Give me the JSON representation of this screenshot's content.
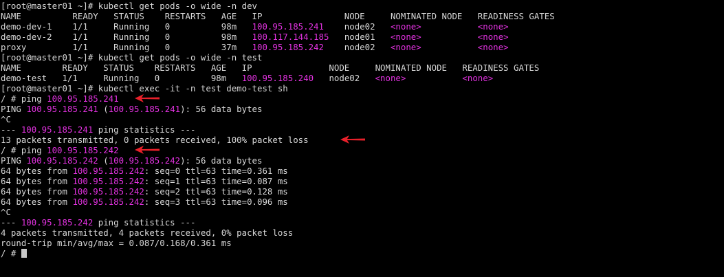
{
  "terminal": {
    "lines": [
      [
        {
          "t": "[root@master01 ~]# kubectl get pods -o wide -n dev"
        }
      ],
      [
        {
          "t": "NAME          READY   STATUS    RESTARTS   AGE   IP                NODE     NOMINATED NODE   READINESS GATES"
        }
      ],
      [
        {
          "t": "demo-dev-1    1/1     Running   0          98m   "
        },
        {
          "t": "100.95.185.241",
          "c": "m"
        },
        {
          "t": "    node02   "
        },
        {
          "t": "<none>",
          "c": "m"
        },
        {
          "t": "           "
        },
        {
          "t": "<none>",
          "c": "m"
        }
      ],
      [
        {
          "t": "demo-dev-2    1/1     Running   0          98m   "
        },
        {
          "t": "100.117.144.185",
          "c": "m"
        },
        {
          "t": "   node01   "
        },
        {
          "t": "<none>",
          "c": "m"
        },
        {
          "t": "           "
        },
        {
          "t": "<none>",
          "c": "m"
        }
      ],
      [
        {
          "t": "proxy         1/1     Running   0          37m   "
        },
        {
          "t": "100.95.185.242",
          "c": "m"
        },
        {
          "t": "    node02   "
        },
        {
          "t": "<none>",
          "c": "m"
        },
        {
          "t": "           "
        },
        {
          "t": "<none>",
          "c": "m"
        }
      ],
      [
        {
          "t": "[root@master01 ~]# kubectl get pods -o wide -n test"
        }
      ],
      [
        {
          "t": "NAME        READY   STATUS    RESTARTS   AGE   IP               NODE     NOMINATED NODE   READINESS GATES"
        }
      ],
      [
        {
          "t": "demo-test   1/1     Running   0          98m   "
        },
        {
          "t": "100.95.185.240",
          "c": "m"
        },
        {
          "t": "   node02   "
        },
        {
          "t": "<none>",
          "c": "m"
        },
        {
          "t": "           "
        },
        {
          "t": "<none>",
          "c": "m"
        }
      ],
      [
        {
          "t": "[root@master01 ~]# kubectl exec -it -n test demo-test sh"
        }
      ],
      [
        {
          "t": "/ # ping "
        },
        {
          "t": "100.95.185.241",
          "c": "m"
        }
      ],
      [
        {
          "t": "PING "
        },
        {
          "t": "100.95.185.241",
          "c": "m"
        },
        {
          "t": " ("
        },
        {
          "t": "100.95.185.241",
          "c": "m"
        },
        {
          "t": "): 56 data bytes"
        }
      ],
      [
        {
          "t": "^C"
        }
      ],
      [
        {
          "t": "--- "
        },
        {
          "t": "100.95.185.241",
          "c": "m"
        },
        {
          "t": " ping statistics ---"
        }
      ],
      [
        {
          "t": "13 packets transmitted, 0 packets received, 100% packet loss"
        }
      ],
      [
        {
          "t": "/ # ping "
        },
        {
          "t": "100.95.185.242",
          "c": "m"
        }
      ],
      [
        {
          "t": "PING "
        },
        {
          "t": "100.95.185.242",
          "c": "m"
        },
        {
          "t": " ("
        },
        {
          "t": "100.95.185.242",
          "c": "m"
        },
        {
          "t": "): 56 data bytes"
        }
      ],
      [
        {
          "t": "64 bytes from "
        },
        {
          "t": "100.95.185.242",
          "c": "m"
        },
        {
          "t": ": seq=0 ttl=63 time=0.361 ms"
        }
      ],
      [
        {
          "t": "64 bytes from "
        },
        {
          "t": "100.95.185.242",
          "c": "m"
        },
        {
          "t": ": seq=1 ttl=63 time=0.087 ms"
        }
      ],
      [
        {
          "t": "64 bytes from "
        },
        {
          "t": "100.95.185.242",
          "c": "m"
        },
        {
          "t": ": seq=2 ttl=63 time=0.128 ms"
        }
      ],
      [
        {
          "t": "64 bytes from "
        },
        {
          "t": "100.95.185.242",
          "c": "m"
        },
        {
          "t": ": seq=3 ttl=63 time=0.096 ms"
        }
      ],
      [
        {
          "t": "^C"
        }
      ],
      [
        {
          "t": "--- "
        },
        {
          "t": "100.95.185.242",
          "c": "m"
        },
        {
          "t": " ping statistics ---"
        }
      ],
      [
        {
          "t": "4 packets transmitted, 4 packets received, 0% packet loss"
        }
      ],
      [
        {
          "t": "round-trip min/avg/max = 0.087/0.168/0.361 ms"
        }
      ],
      [
        {
          "t": "/ # "
        }
      ]
    ]
  },
  "colors": {
    "background": "#000000",
    "text": "#d8d8d8",
    "highlight": "#e232e0",
    "annotation_arrow": "#e8202a"
  },
  "annotations": [
    {
      "icon": "red-arrow-left-icon",
      "points_to_line": 9
    },
    {
      "icon": "red-arrow-left-icon",
      "points_to_line": 13
    },
    {
      "icon": "red-arrow-left-icon",
      "points_to_line": 14
    }
  ]
}
